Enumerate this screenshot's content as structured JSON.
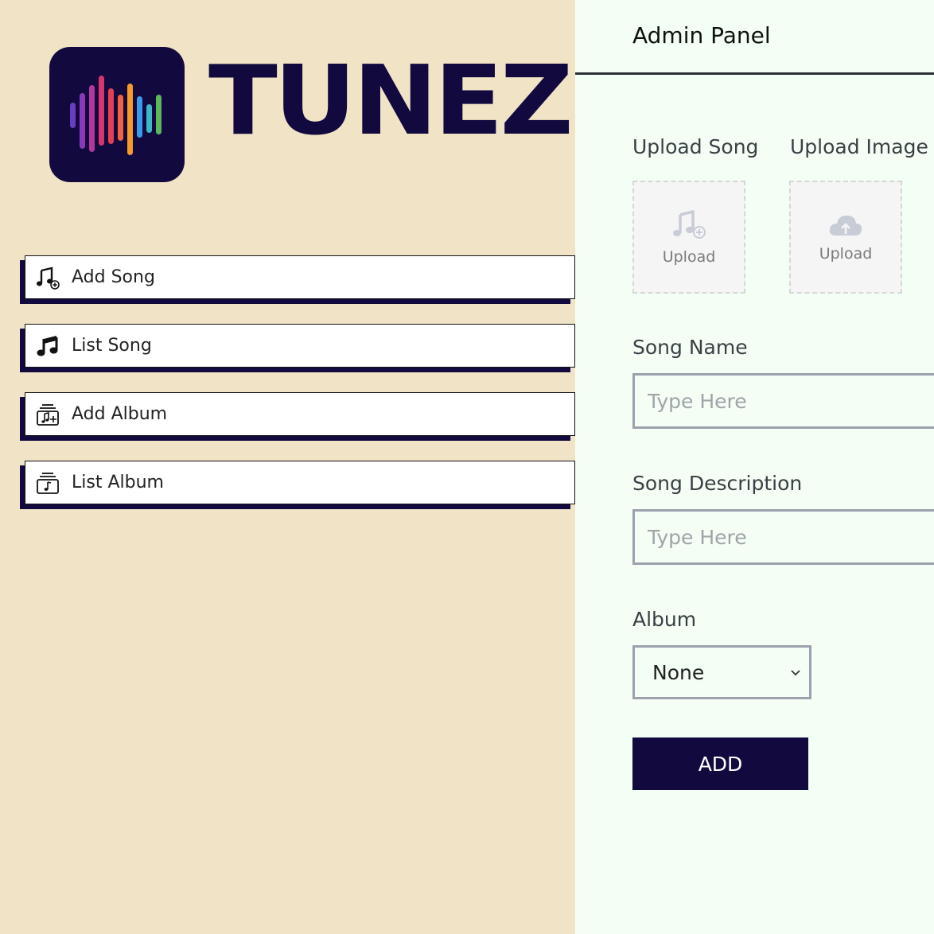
{
  "brand": {
    "name": "TUNEZ"
  },
  "sidebar": {
    "items": [
      {
        "label": "Add Song",
        "icon": "music-note-add-icon"
      },
      {
        "label": "List Song",
        "icon": "music-note-icon"
      },
      {
        "label": "Add Album",
        "icon": "album-add-icon"
      },
      {
        "label": "List Album",
        "icon": "album-list-icon"
      }
    ]
  },
  "header": {
    "title": "Admin Panel"
  },
  "form": {
    "upload_song": {
      "label": "Upload Song",
      "button_text": "Upload",
      "icon": "music-add-icon"
    },
    "upload_image": {
      "label": "Upload Image",
      "button_text": "Upload",
      "icon": "cloud-upload-icon"
    },
    "song_name": {
      "label": "Song Name",
      "placeholder": "Type Here",
      "value": ""
    },
    "song_description": {
      "label": "Song Description",
      "placeholder": "Type Here",
      "value": ""
    },
    "album": {
      "label": "Album",
      "selected": "None"
    },
    "submit_label": "ADD"
  },
  "colors": {
    "sidebar_bg": "#f0e3c6",
    "main_bg": "#f3fff4",
    "brand_navy": "#120a3f"
  }
}
